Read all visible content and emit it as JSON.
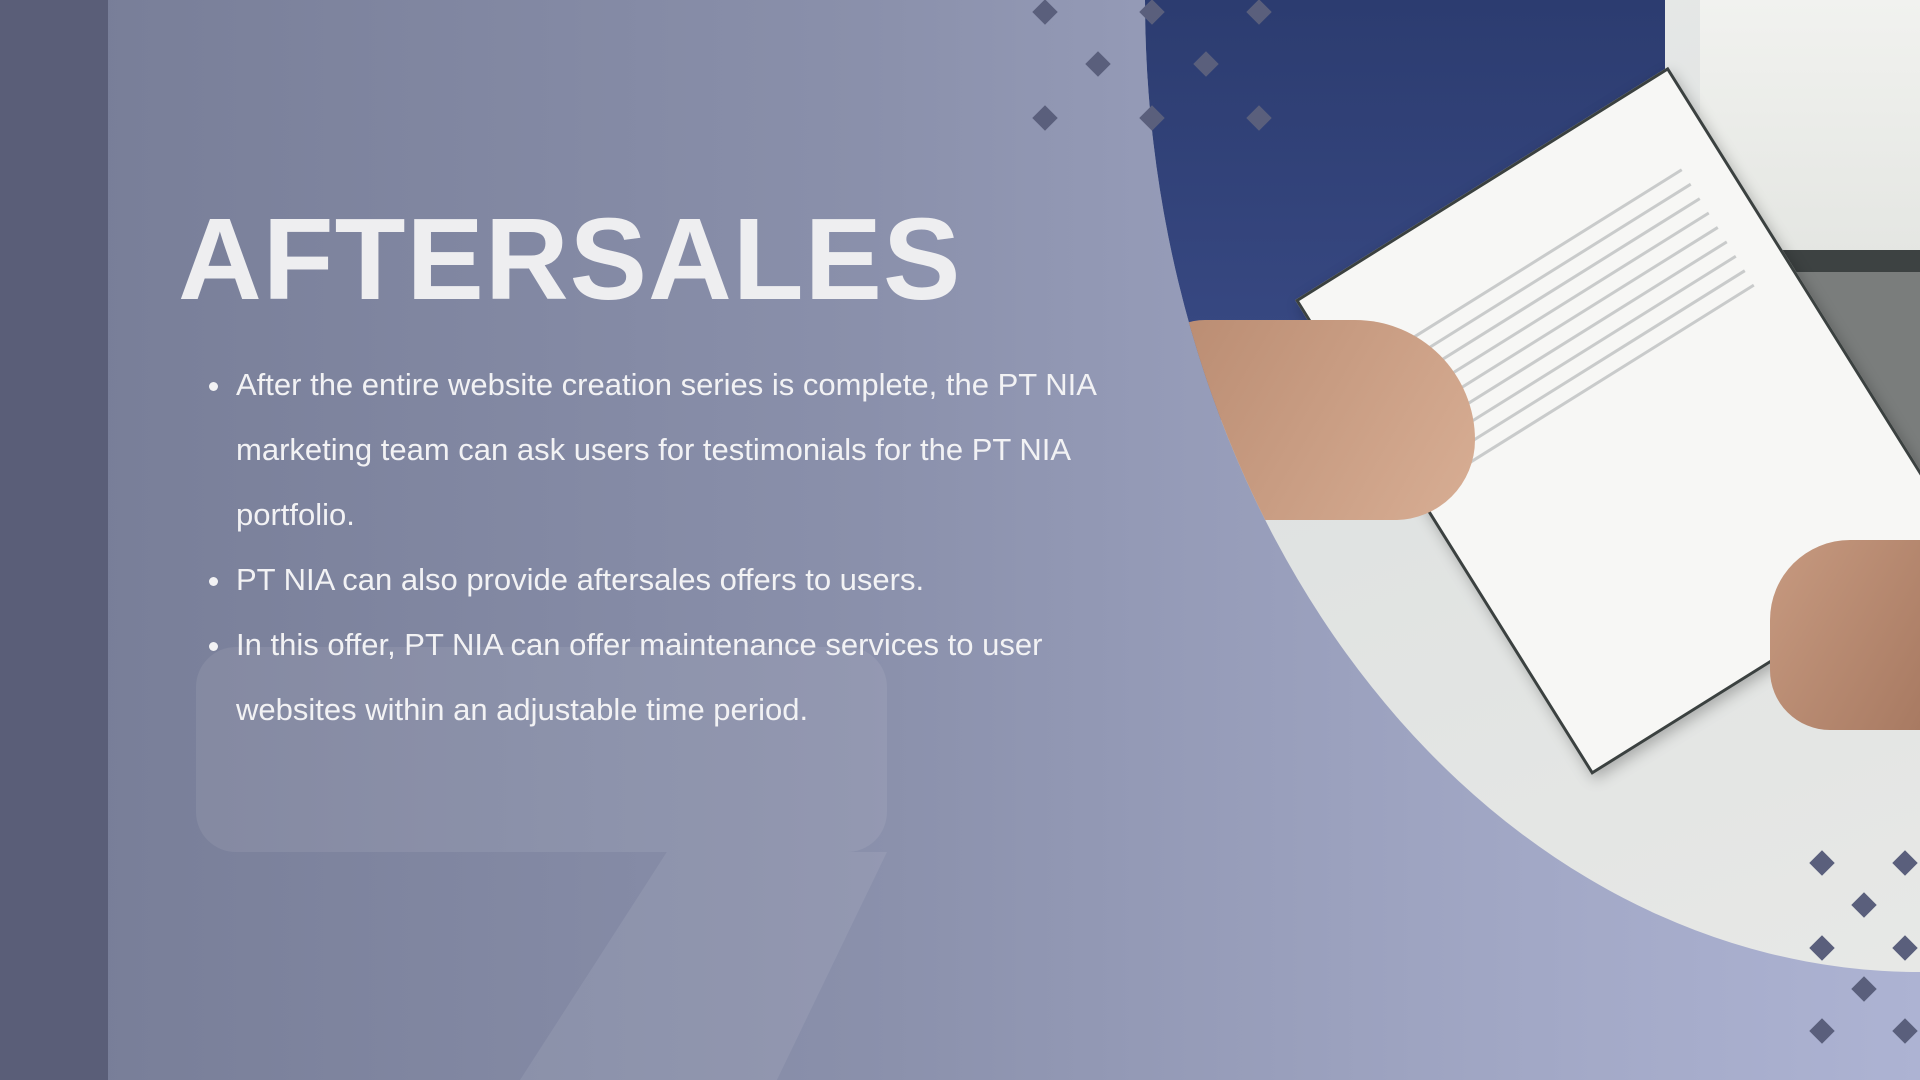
{
  "slide": {
    "title": "AFTERSALES",
    "bullets": [
      "After the entire website creation series is complete, the PT NIA marketing team can ask users for testimonials for the PT NIA portfolio.",
      "PT NIA can also provide aftersales offers to users.",
      "In this offer, PT NIA can offer maintenance services to user websites within an adjustable time period."
    ]
  },
  "colors": {
    "strip": "#5a5e78",
    "diamond": "#5a5f7c",
    "text": "#eeeef0"
  }
}
